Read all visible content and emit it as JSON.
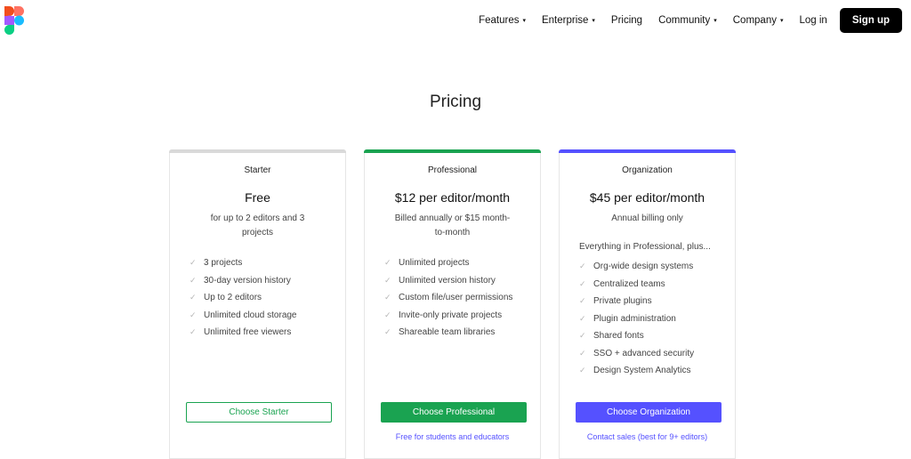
{
  "brand": {
    "colors": {
      "red": "#f24e1e",
      "coral": "#ff7262",
      "purple": "#a259ff",
      "blue": "#1abcfe",
      "green": "#0acf83",
      "primary_green": "#1aa351",
      "primary_purple": "#5551ff"
    },
    "logo_icon": "figma-logo-icon"
  },
  "nav": {
    "items": [
      {
        "label": "Features",
        "has_dropdown": true
      },
      {
        "label": "Enterprise",
        "has_dropdown": true
      },
      {
        "label": "Pricing",
        "has_dropdown": false
      },
      {
        "label": "Community",
        "has_dropdown": true
      },
      {
        "label": "Company",
        "has_dropdown": true
      }
    ],
    "caret": "▾",
    "login_label": "Log in",
    "signup_label": "Sign up"
  },
  "page": {
    "title": "Pricing"
  },
  "plans": [
    {
      "name": "Starter",
      "price": "Free",
      "subtitle": "for up to 2 editors and 3 projects",
      "intro": "",
      "features": [
        "3 projects",
        "30-day version history",
        "Up to 2 editors",
        "Unlimited cloud storage",
        "Unlimited free viewers"
      ],
      "cta": "Choose Starter",
      "sublink": ""
    },
    {
      "name": "Professional",
      "price": "$12 per editor/month",
      "subtitle": "Billed annually or $15 month-to-month",
      "intro": "",
      "features": [
        "Unlimited projects",
        "Unlimited version history",
        "Custom file/user permissions",
        "Invite-only private projects",
        "Shareable team libraries"
      ],
      "cta": "Choose Professional",
      "sublink": "Free for students and educators"
    },
    {
      "name": "Organization",
      "price": "$45 per editor/month",
      "subtitle": "Annual billing only",
      "intro": "Everything in Professional, plus...",
      "features": [
        "Org-wide design systems",
        "Centralized teams",
        "Private plugins",
        "Plugin administration",
        "Shared fonts",
        "SSO + advanced security",
        "Design System Analytics"
      ],
      "cta": "Choose Organization",
      "sublink": "Contact sales (best for 9+ editors)"
    }
  ],
  "check_glyph": "✓"
}
